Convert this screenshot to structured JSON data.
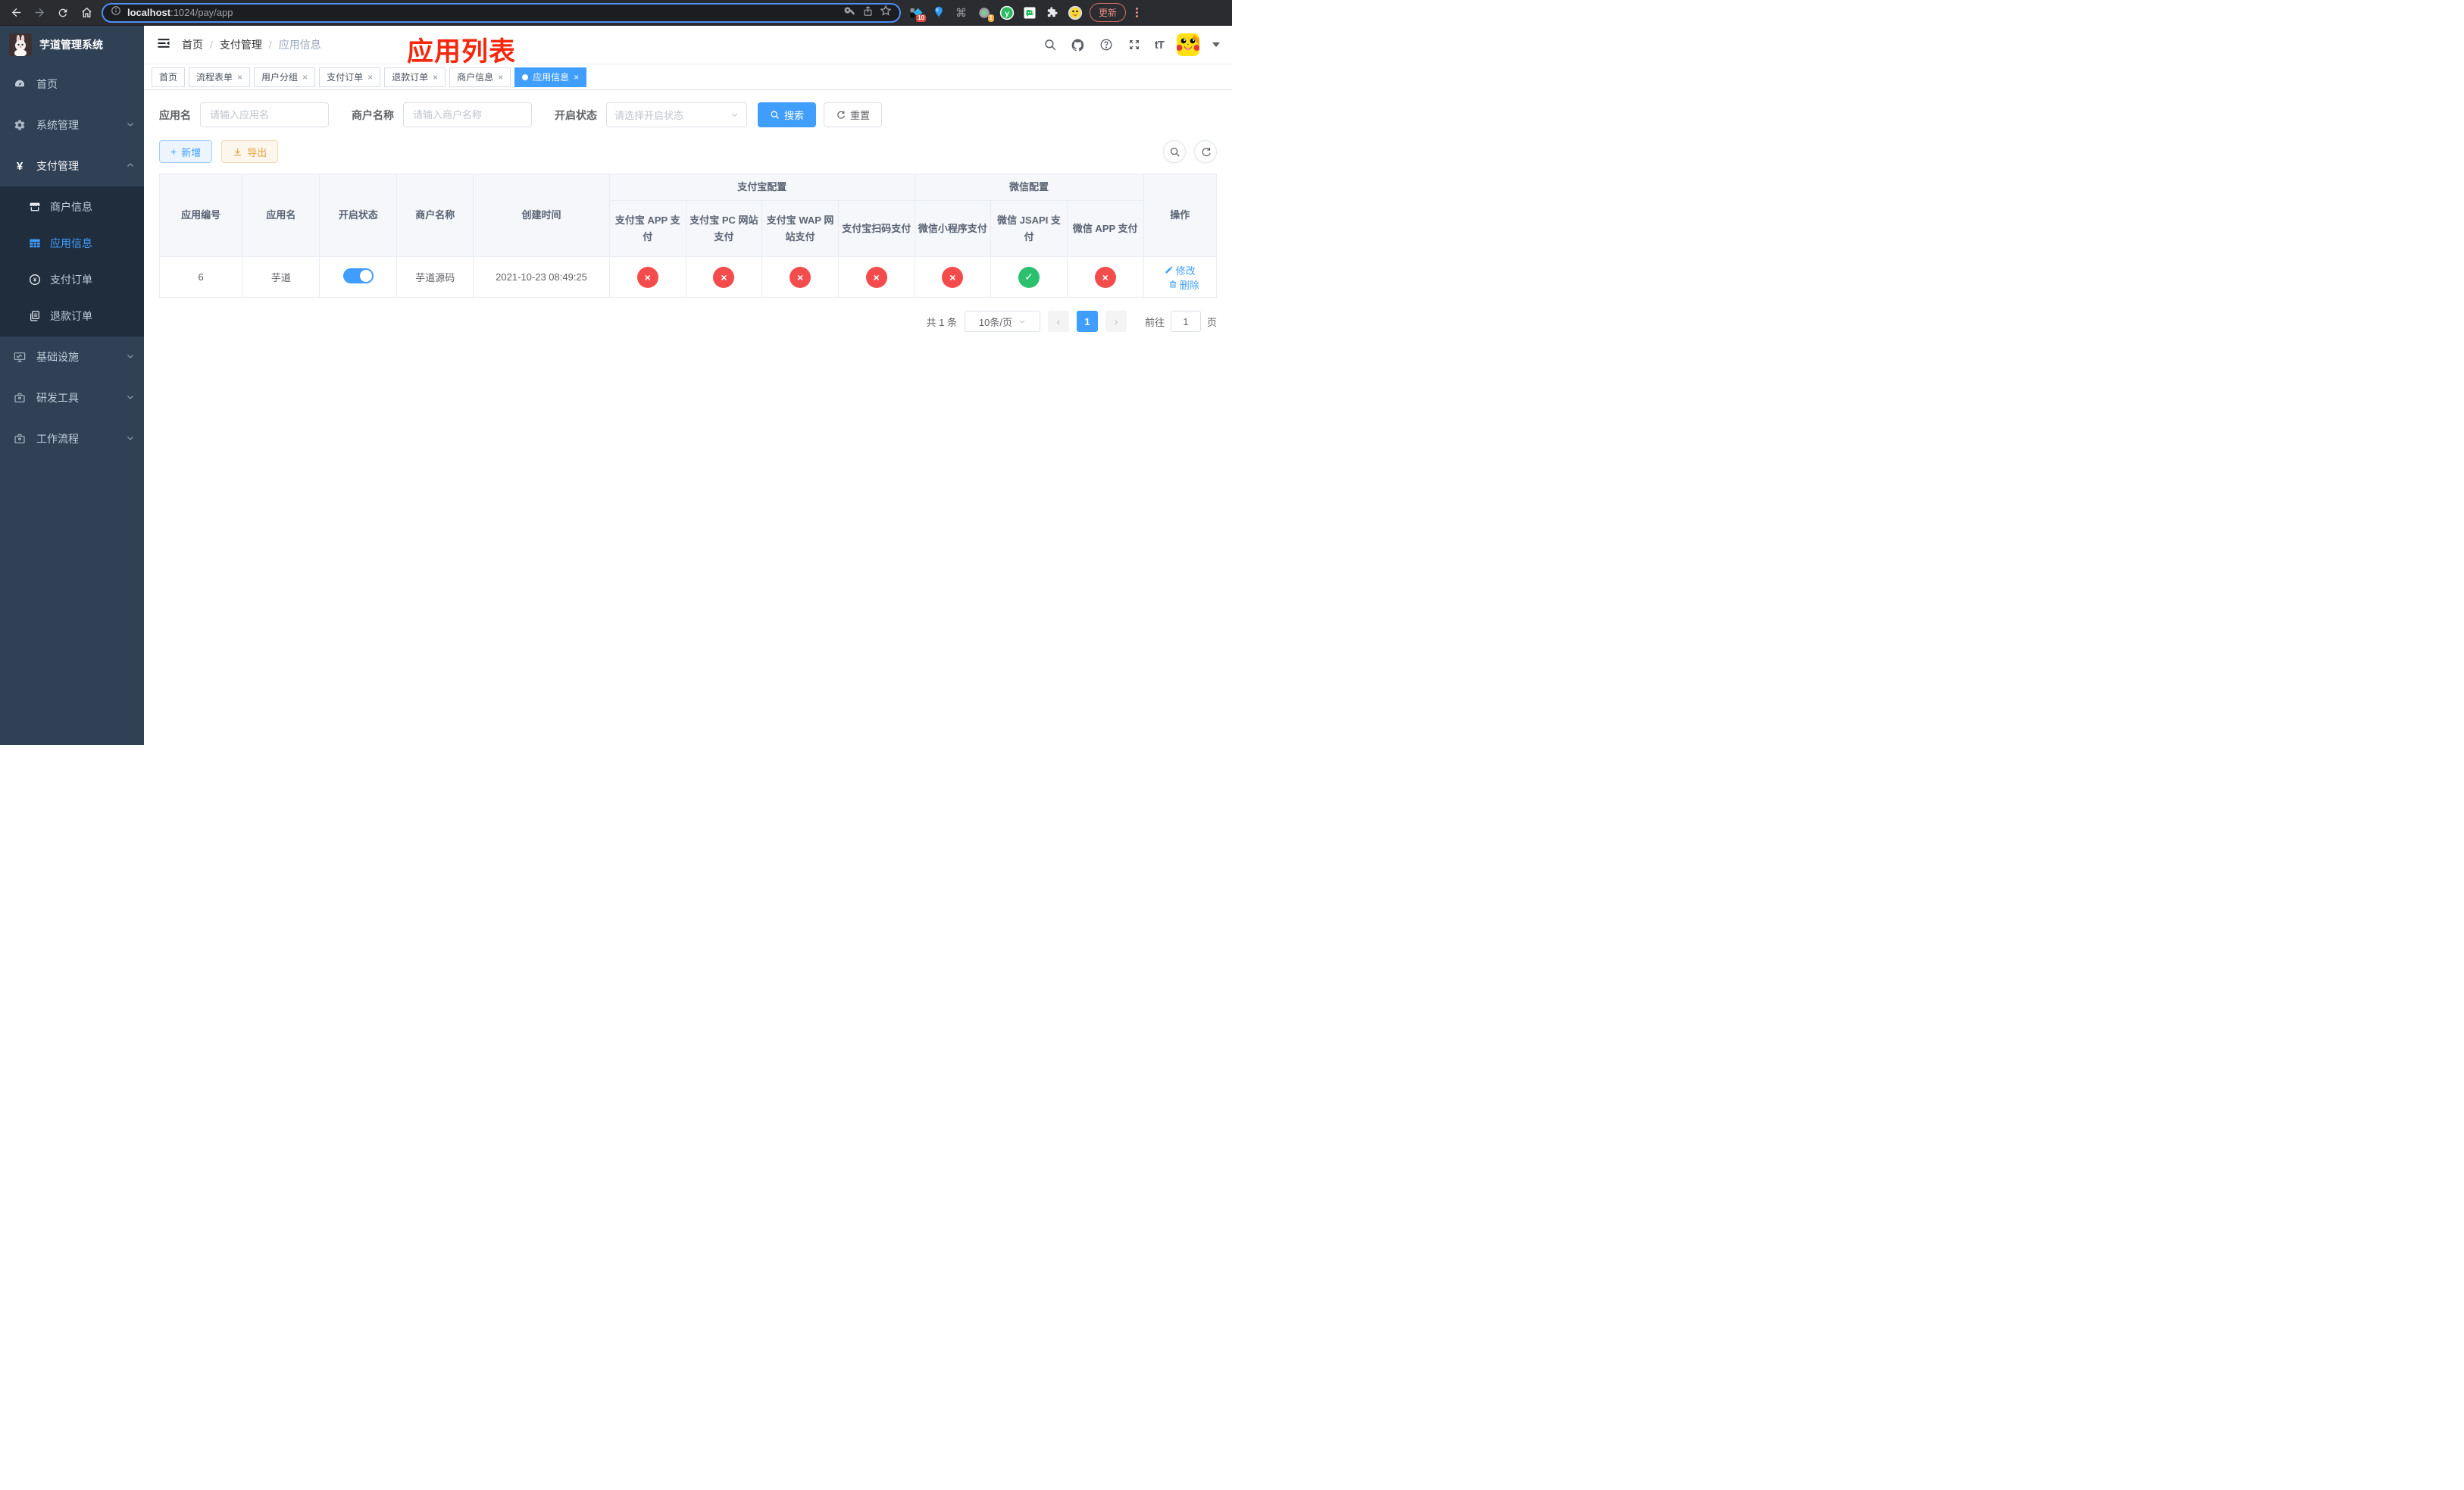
{
  "browser": {
    "url_host": "localhost",
    "url_rest": ":1024/pay/app",
    "ext_badge_blue": "10",
    "ext_badge_circle": "1",
    "update_label": "更新"
  },
  "icons": {
    "close": "×",
    "command": "⌘",
    "prev": "‹",
    "next": "›",
    "plus": "+",
    "caret": "▾",
    "font_size": "tT"
  },
  "annotation": {
    "text": "应用列表"
  },
  "sidebar": {
    "title": "芋道管理系统",
    "items": [
      {
        "label": "首页"
      },
      {
        "label": "系统管理"
      },
      {
        "label": "支付管理"
      },
      {
        "label": "商户信息"
      },
      {
        "label": "应用信息"
      },
      {
        "label": "支付订单"
      },
      {
        "label": "退款订单"
      },
      {
        "label": "基础设施"
      },
      {
        "label": "研发工具"
      },
      {
        "label": "工作流程"
      }
    ]
  },
  "breadcrumb": {
    "separator": "/",
    "items": [
      {
        "label": "首页"
      },
      {
        "label": "支付管理"
      },
      {
        "label": "应用信息"
      }
    ]
  },
  "tabs": [
    {
      "label": "首页"
    },
    {
      "label": "流程表单"
    },
    {
      "label": "用户分组"
    },
    {
      "label": "支付订单"
    },
    {
      "label": "退款订单"
    },
    {
      "label": "商户信息"
    },
    {
      "label": "应用信息"
    }
  ],
  "filter": {
    "app_name_label": "应用名",
    "app_name_placeholder": "请输入应用名",
    "merchant_label": "商户名称",
    "merchant_placeholder": "请输入商户名称",
    "status_label": "开启状态",
    "status_placeholder": "请选择开启状态",
    "search_label": "搜索",
    "reset_label": "重置"
  },
  "toolbar": {
    "add_label": "新增",
    "export_label": "导出"
  },
  "table": {
    "headers": {
      "app_id": "应用编号",
      "app_name": "应用名",
      "status": "开启状态",
      "merchant": "商户名称",
      "created": "创建时间",
      "alipay_group": "支付宝配置",
      "wechat_group": "微信配置",
      "sub": [
        "支付宝 APP 支付",
        "支付宝 PC 网站支付",
        "支付宝 WAP 网站支付",
        "支付宝扫码支付",
        "微信小程序支付",
        "微信 JSAPI 支付",
        "微信 APP 支付"
      ],
      "actions": "操作"
    },
    "rows": [
      {
        "app_id": "6",
        "app_name": "芋道",
        "enabled": true,
        "merchant": "芋道源码",
        "created": "2021-10-23 08:49:25",
        "pay_status": [
          "×",
          "×",
          "×",
          "×",
          "×",
          "✓",
          "×"
        ],
        "edit_label": "修改",
        "delete_label": "删除"
      }
    ]
  },
  "pagination": {
    "total": "共 1 条",
    "page_size": "10条/页",
    "current_page": "1",
    "goto_label": "前往",
    "goto_value": "1",
    "page_suffix": "页"
  },
  "colors": {
    "accent": "#409eff",
    "danger": "#f44c4c",
    "success": "#2ac06d",
    "annotation_red": "#f5270d"
  }
}
